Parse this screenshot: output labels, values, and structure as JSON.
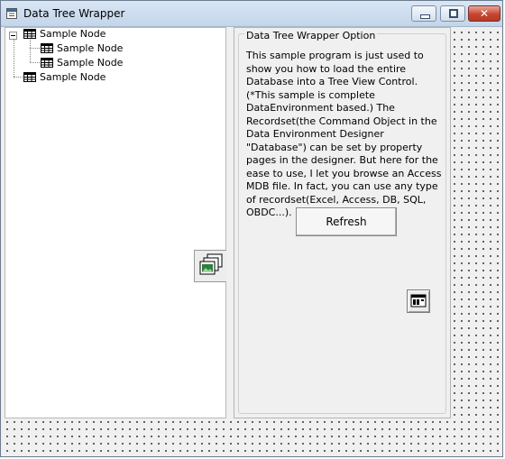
{
  "window": {
    "title": "Data Tree Wrapper",
    "close_glyph": "✕"
  },
  "tree": {
    "nodes": [
      {
        "label": "Sample Node",
        "icon": "table-icon"
      },
      {
        "label": "Sample Node",
        "icon": "table-icon"
      },
      {
        "label": "Sample Node",
        "icon": "table-icon"
      },
      {
        "label": "Sample Node",
        "icon": "table-icon"
      }
    ]
  },
  "options": {
    "title": "Data Tree Wrapper Option",
    "description": "This sample program is just used to show you how to load the entire Database into a Tree View Control. (*This sample is complete DataEnvironment based.) The Recordset(the Command Object in the Data Environment Designer \"Database\") can be set by property pages in the designer. But here for the ease to use, I let you browse an Access MDB file. In fact, you can use any type of recordset(Excel, Access, DB, SQL, OBDC...).",
    "refresh_label": "Refresh"
  },
  "colors": {
    "titlebar": "#c3d5ea",
    "close_button": "#c9442f",
    "form_background": "#f0f0f0"
  }
}
